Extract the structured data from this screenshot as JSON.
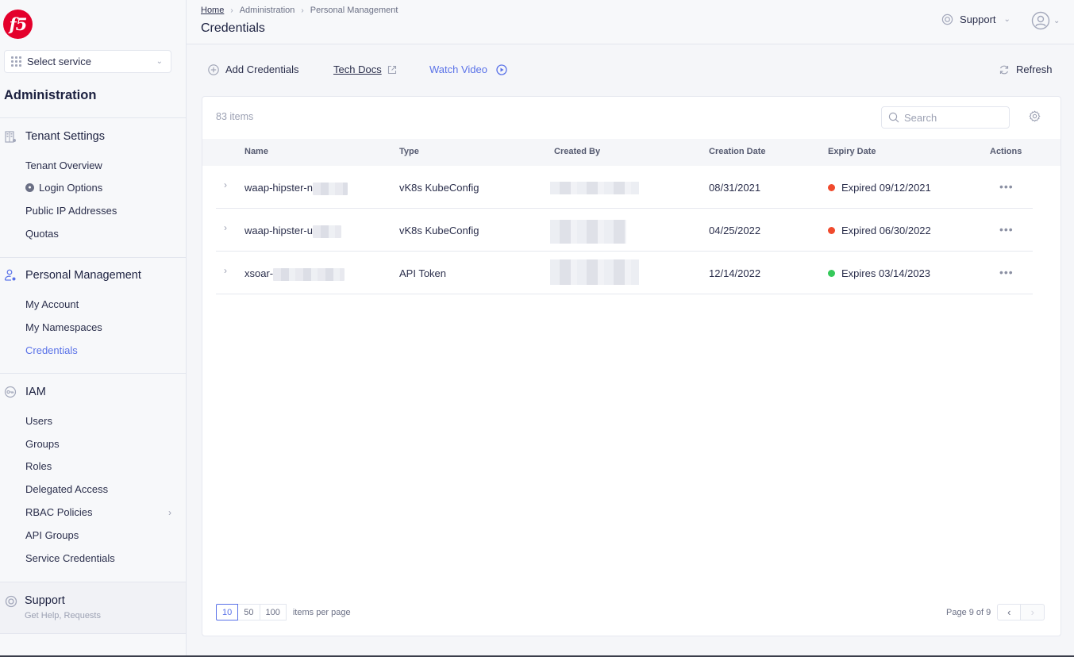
{
  "brand": {
    "logo_text": "f5",
    "logo_color": "#e4002b"
  },
  "sidebar": {
    "service_select": {
      "label": "Select service"
    },
    "title": "Administration",
    "sections": [
      {
        "label": "Tenant Settings",
        "icon": "building-icon",
        "items": [
          {
            "label": "Tenant Overview"
          },
          {
            "label": "Login Options",
            "icon": "lock-icon"
          },
          {
            "label": "Public IP Addresses"
          },
          {
            "label": "Quotas"
          }
        ]
      },
      {
        "label": "Personal Management",
        "icon": "user-gear-icon",
        "items": [
          {
            "label": "My Account"
          },
          {
            "label": "My Namespaces"
          },
          {
            "label": "Credentials",
            "active": true
          }
        ]
      },
      {
        "label": "IAM",
        "icon": "key-icon",
        "items": [
          {
            "label": "Users"
          },
          {
            "label": "Groups"
          },
          {
            "label": "Roles"
          },
          {
            "label": "Delegated Access"
          },
          {
            "label": "RBAC Policies",
            "has_submenu": true
          },
          {
            "label": "API Groups"
          },
          {
            "label": "Service Credentials"
          }
        ]
      }
    ],
    "support": {
      "title": "Support",
      "subtitle": "Get Help, Requests",
      "icon": "lifebuoy-icon"
    }
  },
  "header": {
    "breadcrumb": [
      "Home",
      "Administration",
      "Personal Management"
    ],
    "title": "Credentials",
    "support_menu": "Support",
    "user_icon": "user-circle-icon"
  },
  "toolbar": {
    "add_label": "Add Credentials",
    "docs_label": "Tech Docs",
    "video_label": "Watch Video",
    "refresh_label": "Refresh"
  },
  "table": {
    "count_label": "83 items",
    "search_placeholder": "Search",
    "columns": [
      "Name",
      "Type",
      "Created By",
      "Creation Date",
      "Expiry Date",
      "Actions"
    ],
    "rows": [
      {
        "name": "waap-hipster-n",
        "type": "vK8s KubeConfig",
        "created_by": "[redacted]",
        "creation_date": "08/31/2021",
        "expiry": "Expired 09/12/2021",
        "status": "expired"
      },
      {
        "name": "waap-hipster-u",
        "type": "vK8s KubeConfig",
        "created_by": "[redacted]",
        "creation_date": "04/25/2022",
        "expiry": "Expired 06/30/2022",
        "status": "expired"
      },
      {
        "name": "xsoar-",
        "type": "API Token",
        "created_by": "[redacted]",
        "creation_date": "12/14/2022",
        "expiry": "Expires 03/14/2023",
        "status": "active"
      }
    ],
    "status_colors": {
      "expired": "#f04a2d",
      "active": "#35c95a"
    },
    "per_page_options": [
      "10",
      "50",
      "100"
    ],
    "per_page_selected": "10",
    "per_page_label": "items per page",
    "page_label": "Page 9 of 9",
    "current_page": 9,
    "total_pages": 9
  },
  "colors": {
    "accent": "#5a72e8",
    "text": "#2b2f4c"
  }
}
